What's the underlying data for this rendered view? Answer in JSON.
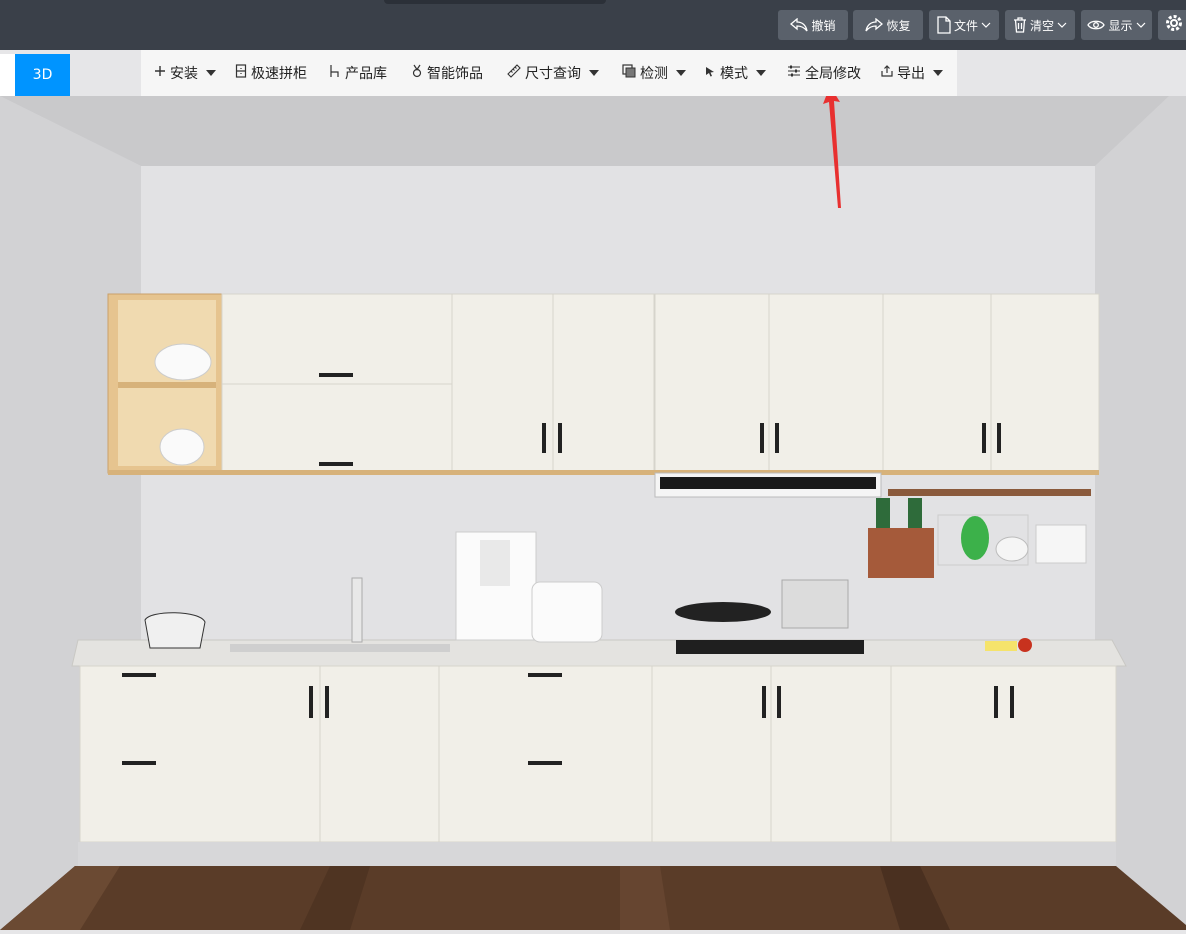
{
  "topbar": {
    "undo_label": "撤销",
    "redo_label": "恢复",
    "file_label": "文件",
    "clear_label": "清空",
    "display_label": "显示"
  },
  "view": {
    "mode_label": "3D"
  },
  "menu": {
    "install": "安装",
    "quick_cabinet": "极速拼柜",
    "product_library": "产品库",
    "smart_decor": "智能饰品",
    "size_query": "尺寸查询",
    "check": "检测",
    "mode": "模式",
    "global_modify": "全局修改",
    "export": "导出"
  },
  "colors": {
    "accent": "#0094ff",
    "topbar": "#3a4049",
    "arrow": "#e83030",
    "cabinet": "#f1efe8",
    "wood": "#e6c48f",
    "floor": "#5a3c28"
  },
  "icons": [
    "undo-icon",
    "redo-icon",
    "file-icon",
    "trash-icon",
    "eye-icon",
    "gear-icon",
    "plus-icon",
    "cabinet-icon",
    "chair-icon",
    "decor-icon",
    "ruler-icon",
    "check-icon",
    "cursor-icon",
    "sliders-icon",
    "export-icon"
  ]
}
